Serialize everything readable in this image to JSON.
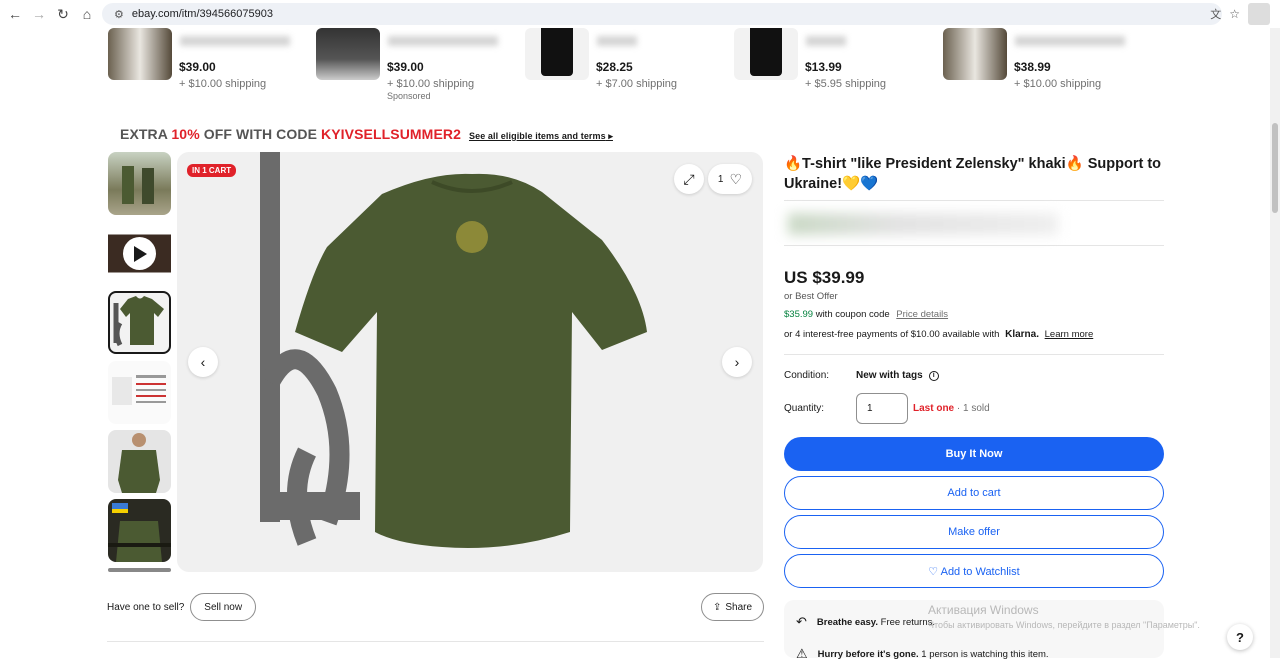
{
  "browser": {
    "url": "ebay.com/itm/394566075903",
    "back_icon": "back-arrow-icon",
    "forward_icon": "forward-arrow-icon",
    "reload_icon": "reload-icon",
    "home_icon": "home-icon"
  },
  "recs": [
    {
      "price": "$39.00",
      "shipping": "+ $10.00 shipping",
      "sponsored": ""
    },
    {
      "price": "$39.00",
      "shipping": "+ $10.00 shipping",
      "sponsored": "Sponsored"
    },
    {
      "price": "$28.25",
      "shipping": "+ $7.00 shipping",
      "sponsored": ""
    },
    {
      "price": "$13.99",
      "shipping": "+ $5.95 shipping",
      "sponsored": ""
    },
    {
      "price": "$38.99",
      "shipping": "+ $10.00 shipping",
      "sponsored": ""
    }
  ],
  "promo": {
    "prefix": "EXTRA ",
    "percent": "10%",
    "middle": " OFF WITH CODE ",
    "code": "KYIVSELLSUMMER2",
    "link": "See all eligible items and terms"
  },
  "gallery": {
    "badge": "IN 1 CART",
    "watch_count": "1"
  },
  "sell": {
    "prompt": "Have one to sell?",
    "sell_now": "Sell now",
    "share": "Share"
  },
  "item": {
    "title": "🔥T-shirt \"like President Zelensky\" khaki🔥 Support to Ukraine!💛💙",
    "price": "US $39.99",
    "best_offer": "or Best Offer",
    "coupon_price": "$35.99",
    "coupon_text": " with coupon code",
    "price_details": "Price details",
    "klarna_prefix": "or 4 interest-free payments of $10.00 available with",
    "klarna_brand": "Klarna.",
    "learn_more": "Learn more",
    "condition_label": "Condition:",
    "condition_value": "New with tags",
    "quantity_label": "Quantity:",
    "quantity_value": "1",
    "last_one": "Last one",
    "sold": " · 1 sold",
    "buy_now": "Buy It Now",
    "add_to_cart": "Add to cart",
    "make_offer": "Make offer",
    "watchlist": "♡ Add to Watchlist",
    "returns_bold": "Breathe easy.",
    "returns_text": " Free returns.",
    "hurry_bold": "Hurry before it's gone.",
    "hurry_text": " 1 person is watching this item."
  },
  "windows": {
    "activate_title": "Активация Windows",
    "activate_text": "Чтобы активировать Windows, перейдите в раздел \"Параметры\"."
  },
  "colors": {
    "accent": "#1a62f2",
    "promo_red": "#e0222a",
    "coupon_green": "#05823f",
    "shirt": "#4b5a32"
  }
}
